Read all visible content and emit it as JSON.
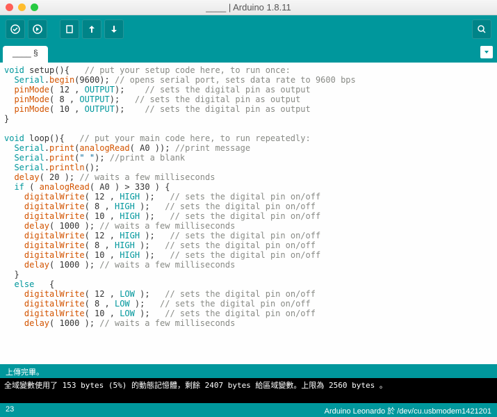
{
  "window": {
    "title": "____ | Arduino 1.8.11"
  },
  "tab": {
    "name": "____ §"
  },
  "code": {
    "lines": [
      [
        {
          "t": "void",
          "c": "kw"
        },
        {
          "t": " setup(){",
          "c": ""
        },
        {
          "t": "   // put your setup code here, to run once:",
          "c": "cm"
        }
      ],
      [
        {
          "t": "  ",
          "c": ""
        },
        {
          "t": "Serial",
          "c": "ty"
        },
        {
          "t": ".",
          "c": ""
        },
        {
          "t": "begin",
          "c": "fn"
        },
        {
          "t": "(9600); ",
          "c": ""
        },
        {
          "t": "// opens serial port, sets data rate to 9600 bps",
          "c": "cm"
        }
      ],
      [
        {
          "t": "  ",
          "c": ""
        },
        {
          "t": "pinMode",
          "c": "fn"
        },
        {
          "t": "( 12 , ",
          "c": ""
        },
        {
          "t": "OUTPUT",
          "c": "ty"
        },
        {
          "t": ");    ",
          "c": ""
        },
        {
          "t": "// sets the digital pin as output",
          "c": "cm"
        }
      ],
      [
        {
          "t": "  ",
          "c": ""
        },
        {
          "t": "pinMode",
          "c": "fn"
        },
        {
          "t": "( 8 , ",
          "c": ""
        },
        {
          "t": "OUTPUT",
          "c": "ty"
        },
        {
          "t": ");   ",
          "c": ""
        },
        {
          "t": "// sets the digital pin as output",
          "c": "cm"
        }
      ],
      [
        {
          "t": "  ",
          "c": ""
        },
        {
          "t": "pinMode",
          "c": "fn"
        },
        {
          "t": "( 10 , ",
          "c": ""
        },
        {
          "t": "OUTPUT",
          "c": "ty"
        },
        {
          "t": ");    ",
          "c": ""
        },
        {
          "t": "// sets the digital pin as output",
          "c": "cm"
        }
      ],
      [
        {
          "t": "}",
          "c": ""
        }
      ],
      [
        {
          "t": "",
          "c": ""
        }
      ],
      [
        {
          "t": "void",
          "c": "kw"
        },
        {
          "t": " loop(){",
          "c": ""
        },
        {
          "t": "   // put your main code here, to run repeatedly:",
          "c": "cm"
        }
      ],
      [
        {
          "t": "  ",
          "c": ""
        },
        {
          "t": "Serial",
          "c": "ty"
        },
        {
          "t": ".",
          "c": ""
        },
        {
          "t": "print",
          "c": "fn"
        },
        {
          "t": "(",
          "c": ""
        },
        {
          "t": "analogRead",
          "c": "fn"
        },
        {
          "t": "( A0 )); ",
          "c": ""
        },
        {
          "t": "//print message",
          "c": "cm"
        }
      ],
      [
        {
          "t": "  ",
          "c": ""
        },
        {
          "t": "Serial",
          "c": "ty"
        },
        {
          "t": ".",
          "c": ""
        },
        {
          "t": "print",
          "c": "fn"
        },
        {
          "t": "(",
          "c": ""
        },
        {
          "t": "\" \"",
          "c": "str"
        },
        {
          "t": "); ",
          "c": ""
        },
        {
          "t": "//print a blank",
          "c": "cm"
        }
      ],
      [
        {
          "t": "  ",
          "c": ""
        },
        {
          "t": "Serial",
          "c": "ty"
        },
        {
          "t": ".",
          "c": ""
        },
        {
          "t": "println",
          "c": "fn"
        },
        {
          "t": "();",
          "c": ""
        }
      ],
      [
        {
          "t": "  ",
          "c": ""
        },
        {
          "t": "delay",
          "c": "fn"
        },
        {
          "t": "( 20 ); ",
          "c": ""
        },
        {
          "t": "// waits a few milliseconds",
          "c": "cm"
        }
      ],
      [
        {
          "t": "  ",
          "c": ""
        },
        {
          "t": "if",
          "c": "kw"
        },
        {
          "t": " ( ",
          "c": ""
        },
        {
          "t": "analogRead",
          "c": "fn"
        },
        {
          "t": "( A0 ) > 330 ) {",
          "c": ""
        }
      ],
      [
        {
          "t": "    ",
          "c": ""
        },
        {
          "t": "digitalWrite",
          "c": "fn"
        },
        {
          "t": "( 12 , ",
          "c": ""
        },
        {
          "t": "HIGH",
          "c": "ty"
        },
        {
          "t": " );   ",
          "c": ""
        },
        {
          "t": "// sets the digital pin on/off",
          "c": "cm"
        }
      ],
      [
        {
          "t": "    ",
          "c": ""
        },
        {
          "t": "digitalWrite",
          "c": "fn"
        },
        {
          "t": "( 8 , ",
          "c": ""
        },
        {
          "t": "HIGH",
          "c": "ty"
        },
        {
          "t": " );   ",
          "c": ""
        },
        {
          "t": "// sets the digital pin on/off",
          "c": "cm"
        }
      ],
      [
        {
          "t": "    ",
          "c": ""
        },
        {
          "t": "digitalWrite",
          "c": "fn"
        },
        {
          "t": "( 10 , ",
          "c": ""
        },
        {
          "t": "HIGH",
          "c": "ty"
        },
        {
          "t": " );   ",
          "c": ""
        },
        {
          "t": "// sets the digital pin on/off",
          "c": "cm"
        }
      ],
      [
        {
          "t": "    ",
          "c": ""
        },
        {
          "t": "delay",
          "c": "fn"
        },
        {
          "t": "( 1000 ); ",
          "c": ""
        },
        {
          "t": "// waits a few milliseconds",
          "c": "cm"
        }
      ],
      [
        {
          "t": "    ",
          "c": ""
        },
        {
          "t": "digitalWrite",
          "c": "fn"
        },
        {
          "t": "( 12 , ",
          "c": ""
        },
        {
          "t": "HIGH",
          "c": "ty"
        },
        {
          "t": " );   ",
          "c": ""
        },
        {
          "t": "// sets the digital pin on/off",
          "c": "cm"
        }
      ],
      [
        {
          "t": "    ",
          "c": ""
        },
        {
          "t": "digitalWrite",
          "c": "fn"
        },
        {
          "t": "( 8 , ",
          "c": ""
        },
        {
          "t": "HIGH",
          "c": "ty"
        },
        {
          "t": " );   ",
          "c": ""
        },
        {
          "t": "// sets the digital pin on/off",
          "c": "cm"
        }
      ],
      [
        {
          "t": "    ",
          "c": ""
        },
        {
          "t": "digitalWrite",
          "c": "fn"
        },
        {
          "t": "( 10 , ",
          "c": ""
        },
        {
          "t": "HIGH",
          "c": "ty"
        },
        {
          "t": " );   ",
          "c": ""
        },
        {
          "t": "// sets the digital pin on/off",
          "c": "cm"
        }
      ],
      [
        {
          "t": "    ",
          "c": ""
        },
        {
          "t": "delay",
          "c": "fn"
        },
        {
          "t": "( 1000 ); ",
          "c": ""
        },
        {
          "t": "// waits a few milliseconds",
          "c": "cm"
        }
      ],
      [
        {
          "t": "  }",
          "c": ""
        }
      ],
      [
        {
          "t": "  ",
          "c": ""
        },
        {
          "t": "else",
          "c": "kw"
        },
        {
          "t": "   {",
          "c": ""
        }
      ],
      [
        {
          "t": "    ",
          "c": ""
        },
        {
          "t": "digitalWrite",
          "c": "fn"
        },
        {
          "t": "( 12 , ",
          "c": ""
        },
        {
          "t": "LOW",
          "c": "ty"
        },
        {
          "t": " );   ",
          "c": ""
        },
        {
          "t": "// sets the digital pin on/off",
          "c": "cm"
        }
      ],
      [
        {
          "t": "    ",
          "c": ""
        },
        {
          "t": "digitalWrite",
          "c": "fn"
        },
        {
          "t": "( 8 , ",
          "c": ""
        },
        {
          "t": "LOW",
          "c": "ty"
        },
        {
          "t": " );   ",
          "c": ""
        },
        {
          "t": "// sets the digital pin on/off",
          "c": "cm"
        }
      ],
      [
        {
          "t": "    ",
          "c": ""
        },
        {
          "t": "digitalWrite",
          "c": "fn"
        },
        {
          "t": "( 10 , ",
          "c": ""
        },
        {
          "t": "LOW",
          "c": "ty"
        },
        {
          "t": " );   ",
          "c": ""
        },
        {
          "t": "// sets the digital pin on/off",
          "c": "cm"
        }
      ],
      [
        {
          "t": "    ",
          "c": ""
        },
        {
          "t": "delay",
          "c": "fn"
        },
        {
          "t": "( 1000 ); ",
          "c": ""
        },
        {
          "t": "// waits a few milliseconds",
          "c": "cm"
        }
      ]
    ]
  },
  "status": {
    "upload": "上傳完畢。",
    "console": "全域變數使用了 153 bytes (5%) 的動態記憶體，剩餘 2407 bytes 給區域變數。上限為 2560 bytes 。",
    "line": "23",
    "board": "Arduino Leonardo 於 /dev/cu.usbmodem1421201"
  }
}
